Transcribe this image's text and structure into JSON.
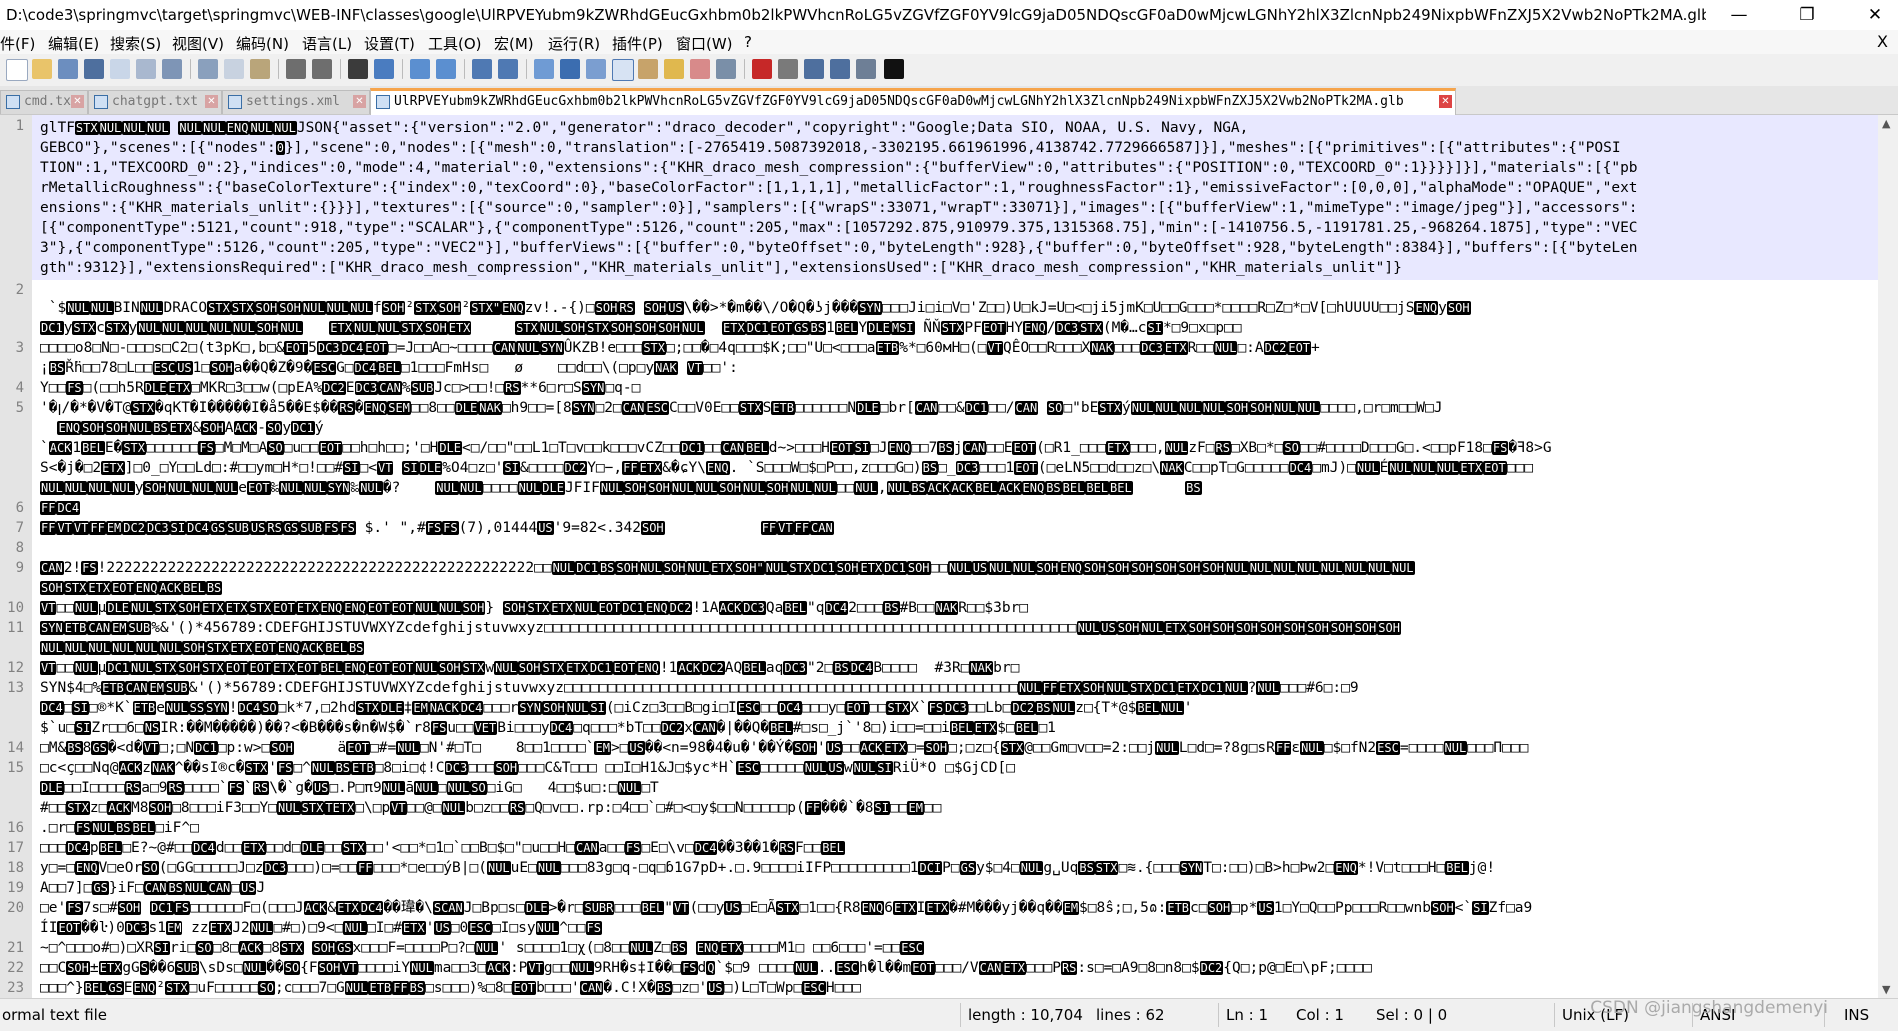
{
  "window": {
    "title": "D:\\code3\\springmvc\\target\\springmvc\\WEB-INF\\classes\\google\\UlRPVEYubm9kZWRhdGEucGxhbm0b2lkPWVhcnRoLG5vZGVfZGF0YV9lcG9jaD05NDQscGF0aD0wMjcwLGNhY2hlX3ZlcnNpb249NixpbWFnZXJ5X2Vwb2NoPTk2MA.glb - ...",
    "minimize": "—",
    "maximize": "❐",
    "close": "✕"
  },
  "menu": {
    "items": [
      "件(F)",
      "编辑(E)",
      "搜索(S)",
      "视图(V)",
      "编码(N)",
      "语言(L)",
      "设置(T)",
      "工具(O)",
      "宏(M)",
      "运行(R)",
      "插件(P)",
      "窗口(W)",
      "?"
    ],
    "close_x": "X"
  },
  "tabs": [
    {
      "label": "cmd.txt",
      "active": false
    },
    {
      "label": "chatgpt.txt",
      "active": false
    },
    {
      "label": "settings.xml",
      "active": false
    },
    {
      "label": "UlRPVEYubm9kZWRhdGEucGxhbm0b2lkPWVhcnRoLG5vZGVfZGF0YV9lcG9jaD05NDQscGF0aD0wMjcwLGNhY2hlX3ZlcnNpb249NixpbWFnZXJ5X2Vwb2NoPTk2MA.glb",
      "active": true
    }
  ],
  "editor": {
    "line_numbers": [
      "1",
      "2",
      "3",
      "4",
      "5",
      "6",
      "7",
      "8",
      "9",
      "10",
      "11",
      "12",
      "13",
      "14",
      "15",
      "16",
      "17",
      "18",
      "19",
      "20",
      "21",
      "22",
      "23"
    ],
    "lines": [
      "glTF[STX][NUL][NUL][NUL] [NUL][NUL][ENQ][NUL][NUL]JSON{\"asset\":{\"version\":\"2.0\",\"generator\":\"draco_decoder\",\"copyright\":\"Google;Data SIO, NOAA, U.S. Navy, NGA,",
      "GEBCO\"},\"scenes\":[{\"nodes\":[0]}],\"scene\":0,\"nodes\":[{\"mesh\":0,\"translation\":[-2765419.5087392018,-3302195.661961996,4138742.7729666587]}],\"meshes\":[{\"primitives\":[{\"attributes\":{\"POSI",
      "TION\":1,\"TEXCOORD_0\":2},\"indices\":0,\"mode\":4,\"material\":0,\"extensions\":{\"KHR_draco_mesh_compression\":{\"bufferView\":0,\"attributes\":{\"POSITION\":0,\"TEXCOORD_0\":1}}}}]}],\"materials\":[{\"pb",
      "rMetallicRoughness\":{\"baseColorTexture\":{\"index\":0,\"texCoord\":0},\"baseColorFactor\":[1,1,1,1],\"metallicFactor\":1,\"roughnessFactor\":1},\"emissiveFactor\":[0,0,0],\"alphaMode\":\"OPAQUE\",\"ext",
      "ensions\":{\"KHR_materials_unlit\":{}}}],\"textures\":[{\"source\":0,\"sampler\":0}],\"samplers\":[{\"wrapS\":33071,\"wrapT\":33071}],\"images\":[{\"bufferView\":1,\"mimeType\":\"image/jpeg\"}],\"accessors\":",
      "[{\"componentType\":5121,\"count\":918,\"type\":\"SCALAR\"},{\"componentType\":5126,\"count\":205,\"max\":[1057292.875,910979.375,1315368.75],\"min\":[-1410756.5,-1191781.25,-968264.1875],\"type\":\"VEC",
      "3\"},{\"componentType\":5126,\"count\":205,\"type\":\"VEC2\"}],\"bufferViews\":[{\"buffer\":0,\"byteOffset\":0,\"byteLength\":928},{\"buffer\":0,\"byteOffset\":928,\"byteLength\":8384}],\"buffers\":[{\"byteLen",
      "gth\":9312}],\"extensionsRequired\":[\"KHR_draco_mesh_compression\",\"KHR_materials_unlit\"],\"extensionsUsed\":[\"KHR_draco_mesh_compression\",\"KHR_materials_unlit\"]}",
      "",
      " `$[NUL][NUL]BIN[NUL]DRACO[STX][STX][SOH][SOH][NUL][NUL][NUL]f[SOH]²[STX][SOH]²[STX\"][ENQ]zv!.-{)□[SOH][RS] [SOH][US]\\��>*�m��\\/O�Q�ʖj���[SYN]□□□Ji□i□V□'Z□□)U□kJ=U□<□ji5jmK□U□□G□□□*□□□□R□Z□*□V[□hUUUU□□jS[ENQ]y[SOH]",
      "[DC1]y[STX]c[STX]y[NUL][NUL][NUL][NUL][NUL][SOH][NUL]   [ETX][NUL][NUL][STX][SOH][ETX]     [STX][NUL][SOH][STX][SOH][SOH][SOH][NUL]  [ETX][DC1][EOT][GS][BS]1[BEL]Y[DLE][MSI] ÑŇ[STX]PF[EOT]HY[ENQ]/[DC3][STX](M�…c[SI]*□9□x□p□□",
      "□□□□o8□N□-□□□s□C2□(t3pK□,b□&[EOT]5[DC3][DC4][EOT]□=J□□A□~□□□□[CAN][NUL][SYN]ÛKZB!e□□□[STX]□;□□�□4q□□□$K;□□\"U□<□□□a[ETB]%*□60мH□(□[VT]QÊO□□R□□□X[NAK]□□□[DC3][ETX]R□□[NUL]□:A[DC2][EOT]+",
      "¡[BS]Ř̈h□□78□L□□[ESC][US]1□[SOH]a��Q�Z�9�[ESC]G□[DC4][BEL]□1□□□FmHs□   ø    □□d□□\\(□p□y[NAK] [VT]□□':",
      "Y□□[FS]□(□□h5R[DLE][ETX]□MKR□3□□w(□pEA%[DC2]E[DC3][CAN]%[SUB]Jc□>□□!□[RS]**6□r□S[SYN]□q-□",
      "'�ꞁ/�*�V�T@[STX]�qKT�I�����I�å5��E$��[RS]�[ENQ][SEM]□□8□□[DLE][NAK]□h9□□=[8[SYN]□2□[CAN][ESC]C□□V0E□□[STX]S[ETB]□□□□□□N[DLE]□br[[CAN]□□&[DC1]□□/[CAN] [SO]□\"bE[STX]ý[NUL][NUL][NUL][NUL][SOH][SOH][NUL][NUL]□□□□,□r□m□□W□J",
      "  [ENQ][SOH][SOH][NUL][BS][ETX]&[SOH]A[ACK]-[SO]y[DC1]ý",
      "`[ACK]1[BEL]E�[STX]□□□□□□[FS]□M□M□A[SO]□u□□[EOT]□□h□h□□;'□H[DLE]<□/□□\"□□L1□T□v□□k□□□vCZ□□[DC1]□□[CAN][BEL]d~>□□□H[EOT][SI]□J[ENQ]□□7[BS]j[CAN]□□E[EOT](□R1_□□□[ETX]□□□,[NUL]zF□[RS]□XB□*□[SO]□□#□□□□D□□□G□.<□□pF18□[FS]�ꟻ8>G",
      "S<�j�□2[ETX]]□0_□Y□□Ld□:#□□ym□H*□!□□#[SI]□<[VT] [SI][DLE]%O4□z□'[SI]&□□□□[DC2]Y□−,[FF][ETX]&�ɕY\\[ENQ]. `S□□□W□$□P□□,z□□□G□)[BS]□_[DC3]□□□1[EOT](□eLN5□□d□□z□\\[NAK]C□□pT□G□□□□□[DC4]□mJ)□[NUL]É[NUL][NUL][NUL][ETX][EOT]□□□",
      "[NUL][NUL][NUL][NUL]y[SOH][NUL][NUL][NUL]e[EOT]‰[NUL][NUL][SYN]‰[NUL]�?    [NUL][NUL]□□□□[NUL][DLE]JFIF[NUL][SOH][SOH][NUL][NUL][SOH][NUL][SOH][NUL][NUL]□□[NUL],[NUL][BS][ACK][ACK][BEL][ACK][ENQ][BS][BEL][BEL][BEL]      [BS]",
      "[FF][DC4]",
      "[FF][VT][VT][FF][EM][DC2][DC3][SI][DC4][GS][SUB][US][RS][GS][SUB][FS][FS] $.' \",#[FS][FS](7),01444[US]'9=82<.342[SOH]           [FF][VT][FF][CAN]",
      "",
      "[CAN]2![FS]!2222222222222222222222222222222222222222222222222□□[NUL][DC1][BS][SOH][NUL][SOH][NUL][ETX][SOH\"][NUL][STX][DC1][SOH][ETX][DC1][SOH]□□[NUL][US][NUL][NUL][SOH][ENQ][SOH][SOH][SOH][SOH][SOH][SOH][NUL][NUL][NUL][NUL][NUL][NUL][NUL][NUL]",
      "[SOH][STX][ETX][EOT][ENQ][ACK][BEL][BS]",
      "[VT]□□[NUL]µ[DLE][NUL][STX][SOH][ETX][ETX][STX][EOT][ETX][ENQ][ENQ][EOT][EOT][NUL][NUL][SOH]} [SOH][STX][ETX][NUL][EOT][DC1][ENQ][DC2]!1A[ACK][DC3]Qa[BEL]\"q[DC4]2□□□[BS]#B□□[NAK]R□□$3br□",
      "[SYN][ETB][CAN][EM][SUB]%&'()*456789:CDEFGHIJSTUVWXYZcdefghijstuvwxyz□□□□□□□□□□□□□□□□□□□□□□□□□□□□□□□□□□□□□□□□□□□□□□□□□□□□□□□□□□□□□[NUL][US][SOH][NUL][ETX][SOH][SOH][SOH][SOH][SOH][SOH][SOH][SOH][SOH]",
      "[NUL][NUL][NUL][NUL][NUL][NUL][SOH][STX][ETX][EOT][ENQ][ACK][BEL][BS]",
      "[VT]□□[NUL]µ[DC1][NUL][STX][SOH][STX][EOT][EOT][ETX][EOT][BEL][ENQ][EOT][EOT][NUL][SOH][STX]w[NUL][SOH][STX][ETX][DC1][EOT][ENQ]!1[ACK][DC2]AQ[BEL]aq[DC3]\"2□[BS][DC4]B□□□□  #3R□[NAK]br□",
      "SYN$4□%[ETB][CAN][EM][SUB]&'()*56789:CDEFGHIJSTUVWXYZcdefghijstuvwxyz□□□□□□□□□□□□□□□□□□□□□□□□□□□□□□□□□□□□□□□□□□□□□□□□□□□□[NUL][FF][ETX][SOH][NUL][STX][DC1][ETX][DC1][NUL]?[NUL]□□□#6□:□9",
      "[DC4]□[SI]□®*K`[ETB]e[NUL][SS][SYN]![DC4][SO]□k*7,□2hd[STX][DLE]‡[EM][NACK][DC4]□□□r[SYN][SOH][NUL][SI](□iCz□3□□B□gi□I[ESC]□□[DC4]□□□y□[EOT]□□[STX]X`[FS][DC3]□□Lb□[DC2][BS][NUL]z□{T*@$[BEL][NUL]'",
      "$`u□[SI]Zr□□6□[NS]IR:��M�����)��?<�B���s�n�W$�`r8[FS]u□□[VET]Bi□□□y[DC4]□q□□□*bT□□[DC2]x[CAN]�|��Q�[BEL]#□s□_j`'8□)i□□=□□i[BEL][ETX]$□[BEL]□1",
      "□M&[BS]8[GS]�<d�[VT]□;□N[DC1]□p:w>□[SOH]     ä[EOT]□#=[NUL]□N'#□T□    8□□1□□□□`[EM]>□[US]��<n=98�4�u�'��Ý�[SOH]'[US]□□[ACK][ETX]□=[SOH]□;□z□{[STX]@□□Gm□v□□=2:□□j[NUL]L□d□=?8g□sR[FF]ɛ[NUL]□$□fN2[ESC]=□□□□[NUL]□□□Π□□□",
      "□c<ç□□Nq@[ACK]z[NAK]^��sI®c�[STX]'[FS]□^[NUL][BS][ETB]□8□i□¢!C[DC3]□□□[SOH]□□□C&T□□□ □□I□H1&J□$yc*H`[ESC]□□□□□[NUL][US]w[NUL][SI]RiÜ*O □$GjCD[□",
      "[DLE]□□I□□□□[RS]a□9[RS]□□□□`[FS]`[RS]\\�`g�[US]□.P□π9[NUL]ā[NUL]□[NUL][SO]□iG□   4□□$u□:□[NUL]□T",
      "#□□[STX]z□[ACK]M8[SOH]□8□□□iF3□□Y□[NUL][STX][TETX]□\\□p[VT]□□@□[NUL]b□z□□[RS]□Q□v□□.rp:□4□□`□#□<□y$□□N□□□□□p([FF]���`�8[SI]□□[EM]□□",
      ".□r□[FS][NUL][BS][BEL]□iF^□",
      "□□□[DC4]p[BEL]□E?~@#□□[DC4]d□□[ETX]□□d□[DLE]□□[STX]□□'<□□*□1□`□□B□$□\"□u□□H□[CAN]a□□[FS]□E□\\v□[DC4]��3��1�[RS]F□□[BEL]",
      "y□=□[ENQ]V□eOr[SO](□GG□□□□□J□z[DC3]□□□)□=□□[FF]□□□*□e□□ýB|□([NUL]uE□[NUL]□□□83g□q-□q□ɓ1G7pD+.□.9□□□□iIFP□□□□□□□□□1[DCI]P□[GS]y$□4□[NUL]g␣Uq[BS][STX]□≋.{□□□[SYN]T□:□□)□B>h□Þw2□[ENQ]*!V□t□□□H□[BEL]j@!",
      "A□□7]□[GS]}iF□[CAN][BS][NUL][CAN]□[US]J",
      "□e'[FS]7s□#[SOH] [DC1][FS]□□□□□□F□(□□□J[ACK]&[ETX][DC4]��瑋�\\[SCAN]J□Bp□s□[DLE]>�r□[SUBR]□□□[BEL]\"[VT](□□y[US]□E□Ã[STX]□1□□{R8[ENQ]6[ETX]I[ETX]�#M���yj��q��[EM]$□8ŝ;□,5ɷ:[ETB]c□[SOH]□p*[US]1□Y□Q□□Pp□□□R□□wnb[SOH]<`[SI]Zf□a9",
      "ÍI[EOT]��ŀ)0[DC3]s1[EM] zz[ETX]J2[NUL]□#□)□9<□[NUL]□I□#[ETX]'[US]□0[ESC]□I□sy[NUL]^□□[FS]",
      "~□^□□□o#□)□XR[SI]ri□[SO]□8□[ACK]□8[STX] [SOH][GS]x□□□F=□□□□P□?□[NUL]' s□□□□1□χ(□8□□[NUL]Z□[BS] [ENQ][ETX]□□□□M1□ □□6□□□'=□□[ESC]",
      "□□C[SOH]±[ETX]gG[S]��6[SUB]\\sDs□[NUL]��[SO]{F[SOH][VT]□□□□iY[NUL]ma□□3□[ACK]:P[VT]g□□[NUL]9RH�s‡I��□[FS]d[Q]`$□9 □□□□[NUL]..[ESC]h�l��m[EOT]□□□/V[CAN][ETX]□□□P[RS]:s□=□A9□8□n8□$[DC2]{Q□;p@□E□\\pF;□□□□",
      "□□□^}[BEL][GS]E[ENQ]²[STX]□uF□□□□□[SO];c□□□7□G[NUL][ETB][FF][BS]□s□□□)%□8□[EOT]b□□□'[CAN]�.C!X�[BS]□z□'[US]□)L□T□Wp□[ESC]H□□□"
    ]
  },
  "status": {
    "file_type": "ormal text file",
    "length": "length : 10,704",
    "lines": "lines : 62",
    "ln": "Ln : 1",
    "col": "Col : 1",
    "sel": "Sel : 0 | 0",
    "eol": "Unix (LF)",
    "encoding": "ANSI",
    "ins": "INS",
    "watermark": "CSDN @jiangshangdemenyi"
  },
  "colors": {
    "accent": "#f6a44b",
    "current_line": "#e8e8ff",
    "control_char_bg": "#000000"
  }
}
